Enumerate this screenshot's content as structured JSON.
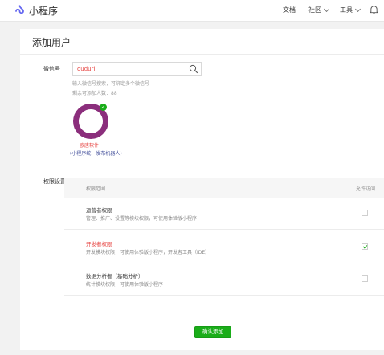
{
  "header": {
    "brand": "小程序",
    "nav": {
      "docs": "文档",
      "community": "社区",
      "tools": "工具"
    },
    "brand_color": "#6467f0"
  },
  "page": {
    "title": "添加用户"
  },
  "form": {
    "wechat_label": "微信号",
    "search_value": "ouduri",
    "hint_line1": "输入微信号搜索，可绑定多个微信号",
    "hint_line2": "剩余可添加人数：88",
    "avatar_name": "欧唐软件",
    "avatar_note": "(小程序统一发布机器人)",
    "permission_label": "权限设置",
    "accent_color": "#1aad19",
    "avatar_ring_color": "#8b2e7c"
  },
  "permissions": {
    "header_left": "权限范围",
    "header_right": "允许访问",
    "rows": [
      {
        "title": "运营者权限",
        "desc": "管理、推广、设置等模块权限，可使用体验版小程序",
        "checked": false
      },
      {
        "title": "开发者权限",
        "desc": "开发模块权限，可使用体验版小程序，开发者工具（IDE）",
        "checked": true
      },
      {
        "title": "数据分析者（基础分析）",
        "desc": "统计模块权限，可使用体验版小程序",
        "checked": false
      }
    ]
  },
  "actions": {
    "confirm_label": "确认添加"
  }
}
